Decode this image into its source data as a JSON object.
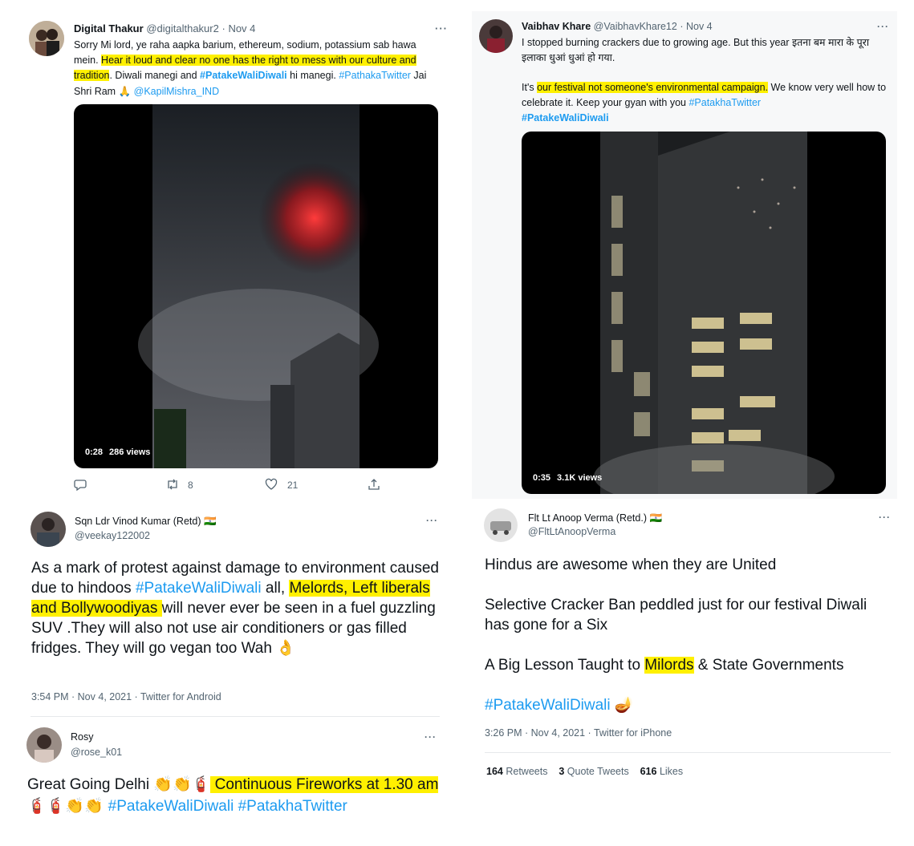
{
  "tweet1": {
    "name": "Digital Thakur",
    "handle": "@digitalthakur2",
    "dot": "·",
    "date": "Nov 4",
    "more": "···",
    "text_a": "Sorry Mi lord, ye raha aapka barium, ethereum, sodium, potassium sab hawa mein. ",
    "text_hl": "Hear it loud and clear no one has the right to mess with our culture and tradition",
    "text_b": ". Diwali manegi and ",
    "tag1": "#PatakeWaliDiwali",
    "text_c": " hi manegi.",
    "tag2": "#PathakaTwitter",
    "text_d": " Jai Shri Ram ",
    "emoji_pray": "🙏",
    "mention": "@KapilMishra_IND",
    "video_time": "0:28",
    "video_views": "286 views",
    "retweets": "8",
    "likes": "21"
  },
  "tweet2": {
    "name": "Vaibhav Khare",
    "handle": "@VaibhavKhare12",
    "dot": "·",
    "date": "Nov 4",
    "more": "···",
    "line1": "I stopped burning crackers due to growing age. But this year इतना बम मारा के पूरा इलाका धुआं धुआं हो गया.",
    "text_a": "It's ",
    "text_hl": "our festival not someone's environmental campaign.",
    "text_b": " We know very well how to celebrate it. Keep your gyan with you ",
    "tag1": "#PatakhaTwitter",
    "tag2": "#PatakeWaliDiwali",
    "video_time": "0:35",
    "video_views": "3.1K views"
  },
  "tweet3": {
    "name": "Sqn Ldr Vinod Kumar (Retd)",
    "flag": "🇮🇳",
    "handle": "@veekay122002",
    "more": "···",
    "text_a": "As a mark of protest against damage to environment caused due to hindoos ",
    "tag": "#PatakeWaliDiwali",
    "text_b": " all, ",
    "text_hl": "Melords, Left liberals and  Bollywoodiyas ",
    "text_c": " will never ever be seen in a fuel guzzling SUV .They will also not use air conditioners or gas filled fridges. They will go vegan too Wah ",
    "emoji_ok": "👌",
    "meta": "3:54 PM · Nov 4, 2021 · Twitter for Android"
  },
  "tweet4": {
    "name": "Flt Lt Anoop Verma (Retd.)",
    "flag": "🇮🇳",
    "handle": "@FltLtAnoopVerma",
    "more": "···",
    "p1": "Hindus are awesome when they are United",
    "p2": "Selective Cracker Ban peddled just for our festival Diwali has gone for a Six",
    "p3_a": "A Big Lesson Taught to ",
    "p3_hl": "Milords",
    "p3_b": " & State Governments",
    "tag": "#PatakeWaliDiwali",
    "emoji_diya": "🪔",
    "meta": "3:26 PM · Nov 4, 2021 · Twitter for iPhone",
    "retweets_n": "164",
    "retweets_l": "Retweets",
    "quotes_n": "3",
    "quotes_l": "Quote Tweets",
    "likes_n": "616",
    "likes_l": "Likes"
  },
  "tweet5": {
    "name": "Rosy",
    "handle": "@rose_k01",
    "more": "···",
    "text_a": "Great Going Delhi ",
    "emoji_a": "👏👏🧯",
    "text_hl": " Continuous Fireworks at 1.30 am",
    "emoji_b": " 🧯🧯👏👏 ",
    "tag1": "#PatakeWaliDiwali",
    "tag2": "#PatakhaTwitter"
  }
}
